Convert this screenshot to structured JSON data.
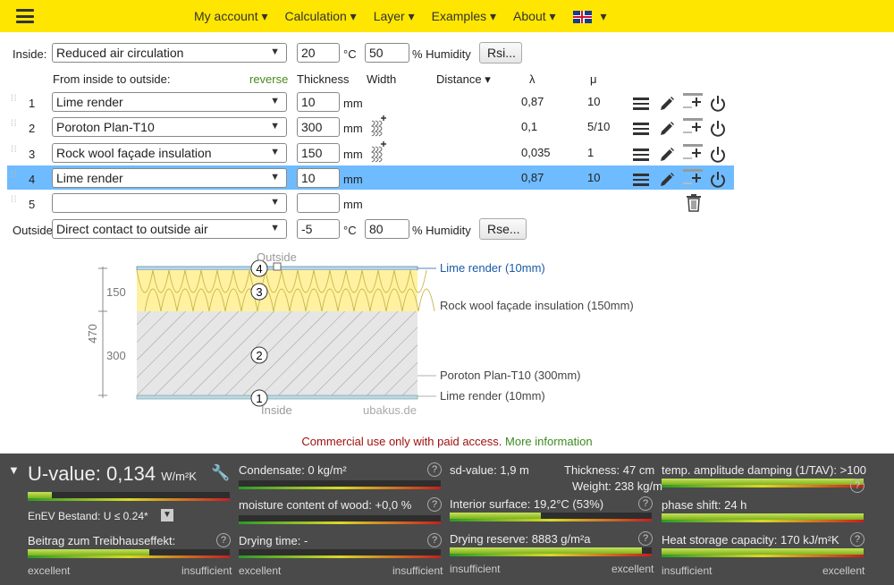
{
  "nav": {
    "items": [
      "My account ▾",
      "Calculation ▾",
      "Layer ▾",
      "Examples ▾",
      "About ▾"
    ],
    "lang_caret": "▾"
  },
  "inside": {
    "label": "Inside:",
    "condition": "Reduced air circulation",
    "temp": "20",
    "temp_unit": "°C",
    "humidity": "50",
    "humidity_unit": "% Humidity",
    "btn": "Rsi..."
  },
  "header": {
    "from_label": "From inside to outside:",
    "reverse": "reverse",
    "thickness": "Thickness",
    "width": "Width",
    "distance": "Distance ▾",
    "lambda": "λ",
    "mu": "μ"
  },
  "layers": [
    {
      "num": "1",
      "material": "Lime render",
      "thickness": "10",
      "unit": "mm",
      "lambda": "0,87",
      "mu": "10"
    },
    {
      "num": "2",
      "material": "Poroton Plan-T10",
      "thickness": "300",
      "unit": "mm",
      "lambda": "0,1",
      "mu": "5/10"
    },
    {
      "num": "3",
      "material": "Rock wool façade insulation",
      "thickness": "150",
      "unit": "mm",
      "lambda": "0,035",
      "mu": "1"
    },
    {
      "num": "4",
      "material": "Lime render",
      "thickness": "10",
      "unit": "mm",
      "lambda": "0,87",
      "mu": "10"
    },
    {
      "num": "5",
      "material": "",
      "thickness": "",
      "unit": "mm",
      "lambda": "",
      "mu": ""
    }
  ],
  "outside": {
    "label": "Outside",
    "condition": "Direct contact to outside air",
    "temp": "-5",
    "temp_unit": "°C",
    "humidity": "80",
    "humidity_unit": "% Humidity",
    "btn": "Rse..."
  },
  "diagram": {
    "outside": "Outside",
    "inside": "Inside",
    "watermark": "ubakus.de",
    "total": "470",
    "dim_top": "150",
    "dim_bottom": "300",
    "labels": [
      "Lime render (10mm)",
      "Rock wool façade insulation (150mm)",
      "Poroton Plan-T10 (300mm)",
      "Lime render (10mm)"
    ],
    "circles": [
      "4",
      "3",
      "2",
      "1"
    ],
    "colors": {
      "render": "#bcd7e6",
      "insulation": "#fff1a0",
      "brick": "#d9d9d9",
      "label_blue": "#1a5aa8"
    }
  },
  "notice": {
    "text": "Commercial use only with paid access.",
    "link": "More information"
  },
  "results": {
    "u_label": "U-value:",
    "u_value": "0,134",
    "u_unit": "W/m²K",
    "u_level": 0.12,
    "enev": "EnEV Bestand: U ≤ 0.24*",
    "greenhouse": "Beitrag zum Treibhauseffekt:",
    "greenhouse_level": 0.6,
    "condensate": "Condensate: 0 kg/m²",
    "condensate_level": 0.0,
    "moisture": "moisture content of wood: +0,0 %",
    "moisture_level": 0.0,
    "drying": "Drying time: -",
    "drying_level": 0.0,
    "sd": "sd-value: 1,9 m",
    "thickness": "Thickness: 47 cm",
    "weight": "Weight: 238 kg/m²",
    "interior": "Interior surface: 19,2°C (53%)",
    "interior_level": 0.45,
    "reserve": "Drying reserve: 8883 g/m²a",
    "reserve_level": 0.95,
    "damping": "temp. amplitude damping (1/TAV): >100",
    "damping_level": 1.0,
    "phase": "phase shift: 24 h",
    "phase_level": 1.0,
    "heat": "Heat storage capacity: 170 kJ/m²K",
    "heat_level": 1.0,
    "excellent": "excellent",
    "insufficient": "insufficient",
    "help": "?"
  }
}
